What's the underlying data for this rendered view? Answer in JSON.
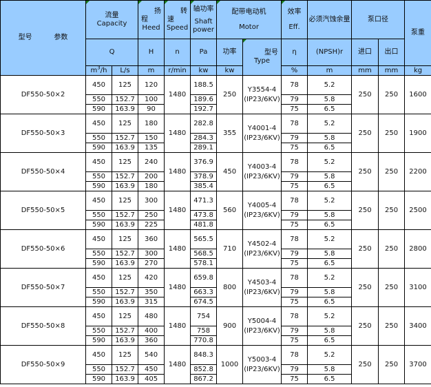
{
  "header": {
    "model_label": "型号",
    "param_label": "参数",
    "capacity_cn": "流量",
    "capacity_en": "Capacity",
    "head_cn_top": "扬",
    "head_cn_bottom": "程",
    "head_en": "Heed",
    "speed_cn_top": "转",
    "speed_cn_bottom": "速",
    "speed_en": "Speed",
    "shaft_cn": "轴功率",
    "shaft_en_1": "Shaft",
    "shaft_en_2": "power",
    "motor_cn": "配带电动机",
    "motor_en": "Motor",
    "eff_cn": "效率",
    "eff_en": "Eff.",
    "npsh_cn": "必须汽蚀余量",
    "bore_cn": "泵口径",
    "weight_cn": "泵重",
    "sym_q": "Q",
    "sym_h": "H",
    "sym_n": "n",
    "sym_pa": "Pa",
    "motor_power_cn": "功率",
    "motor_type_cn": "型号",
    "motor_type_en": "Type",
    "sym_eta": "η",
    "sym_npsh": "(NPSH)r",
    "inlet_cn": "进口",
    "outlet_cn": "出口",
    "unit_q1_base": "m",
    "unit_q1_sup": "3",
    "unit_q1_rest": "/h",
    "unit_q2": "L/s",
    "unit_h": "m",
    "unit_n": "r/min",
    "unit_pa": "kw",
    "unit_motor_kw": "kw",
    "unit_eta": "%",
    "unit_npsh": "m",
    "unit_inlet": "mm",
    "unit_outlet": "mm",
    "unit_weight": "kg"
  },
  "models": [
    {
      "model": "DF550-50×2",
      "speed": "1480",
      "motor_kw": "250",
      "motor_type_1": "Y3554-4",
      "motor_type_2": "(IP23/6KV)",
      "inlet": "250",
      "outlet": "250",
      "weight": "1600",
      "rows": [
        {
          "q_m3h": "450",
          "q_ls": "125",
          "h": "120",
          "pa": "188.5",
          "eta": "78",
          "npsh": "5.2"
        },
        {
          "q_m3h": "550",
          "q_ls": "152.7",
          "h": "100",
          "pa": "189.6",
          "eta": "79",
          "npsh": "5.8"
        },
        {
          "q_m3h": "590",
          "q_ls": "163.9",
          "h": "90",
          "pa": "192.7",
          "eta": "75",
          "npsh": "6.5"
        }
      ]
    },
    {
      "model": "DF550-50×3",
      "speed": "1480",
      "motor_kw": "355",
      "motor_type_1": "Y4001-4",
      "motor_type_2": "(IP23/6KV)",
      "inlet": "250",
      "outlet": "250",
      "weight": "1900",
      "rows": [
        {
          "q_m3h": "450",
          "q_ls": "125",
          "h": "180",
          "pa": "282.8",
          "eta": "78",
          "npsh": "5.2"
        },
        {
          "q_m3h": "550",
          "q_ls": "152.7",
          "h": "150",
          "pa": "284.3",
          "eta": "79",
          "npsh": "5.8"
        },
        {
          "q_m3h": "590",
          "q_ls": "163.9",
          "h": "135",
          "pa": "289.1",
          "eta": "75",
          "npsh": "6.5"
        }
      ]
    },
    {
      "model": "DF550-50×4",
      "speed": "1480",
      "motor_kw": "450",
      "motor_type_1": "Y4003-4",
      "motor_type_2": "(IP23/6KV)",
      "inlet": "250",
      "outlet": "250",
      "weight": "2200",
      "rows": [
        {
          "q_m3h": "450",
          "q_ls": "125",
          "h": "240",
          "pa": "376.9",
          "eta": "78",
          "npsh": "5.2"
        },
        {
          "q_m3h": "550",
          "q_ls": "152.7",
          "h": "200",
          "pa": "378.9",
          "eta": "79",
          "npsh": "5.8"
        },
        {
          "q_m3h": "590",
          "q_ls": "163.9",
          "h": "180",
          "pa": "385.4",
          "eta": "75",
          "npsh": "6.5"
        }
      ]
    },
    {
      "model": "DF550-50×5",
      "speed": "1480",
      "motor_kw": "560",
      "motor_type_1": "Y4005-4",
      "motor_type_2": "(IP23/6KV)",
      "inlet": "250",
      "outlet": "250",
      "weight": "2500",
      "rows": [
        {
          "q_m3h": "450",
          "q_ls": "125",
          "h": "300",
          "pa": "471.3",
          "eta": "78",
          "npsh": "5.2"
        },
        {
          "q_m3h": "550",
          "q_ls": "152.7",
          "h": "250",
          "pa": "473.8",
          "eta": "79",
          "npsh": "5.8"
        },
        {
          "q_m3h": "590",
          "q_ls": "163.9",
          "h": "225",
          "pa": "481.8",
          "eta": "75",
          "npsh": "6.5"
        }
      ]
    },
    {
      "model": "DF550-50×6",
      "speed": "1480",
      "motor_kw": "710",
      "motor_type_1": "Y4502-4",
      "motor_type_2": "(IP23/6KV)",
      "inlet": "250",
      "outlet": "250",
      "weight": "2800",
      "rows": [
        {
          "q_m3h": "450",
          "q_ls": "125",
          "h": "360",
          "pa": "565.5",
          "eta": "78",
          "npsh": "5.2"
        },
        {
          "q_m3h": "550",
          "q_ls": "152.7",
          "h": "300",
          "pa": "568.5",
          "eta": "79",
          "npsh": "5.8"
        },
        {
          "q_m3h": "590",
          "q_ls": "163.9",
          "h": "270",
          "pa": "578.1",
          "eta": "75",
          "npsh": "6.5"
        }
      ]
    },
    {
      "model": "DF550-50×7",
      "speed": "1480",
      "motor_kw": "800",
      "motor_type_1": "Y4503-4",
      "motor_type_2": "(IP23/6KV)",
      "inlet": "250",
      "outlet": "250",
      "weight": "3100",
      "rows": [
        {
          "q_m3h": "450",
          "q_ls": "125",
          "h": "420",
          "pa": "659.8",
          "eta": "78",
          "npsh": "5.2"
        },
        {
          "q_m3h": "550",
          "q_ls": "152.7",
          "h": "350",
          "pa": "663.3",
          "eta": "79",
          "npsh": "5.8"
        },
        {
          "q_m3h": "590",
          "q_ls": "163.9",
          "h": "315",
          "pa": "674.5",
          "eta": "75",
          "npsh": "6.5"
        }
      ]
    },
    {
      "model": "DF550-50×8",
      "speed": "1480",
      "motor_kw": "900",
      "motor_type_1": "Y5004-4",
      "motor_type_2": "(IP23/6KV)",
      "inlet": "250",
      "outlet": "250",
      "weight": "3400",
      "rows": [
        {
          "q_m3h": "450",
          "q_ls": "125",
          "h": "480",
          "pa": "754",
          "eta": "78",
          "npsh": "5.2"
        },
        {
          "q_m3h": "550",
          "q_ls": "152.7",
          "h": "400",
          "pa": "758",
          "eta": "79",
          "npsh": "5.8"
        },
        {
          "q_m3h": "590",
          "q_ls": "163.9",
          "h": "360",
          "pa": "770.8",
          "eta": "75",
          "npsh": "6.5"
        }
      ]
    },
    {
      "model": "DF550-50×9",
      "speed": "1480",
      "motor_kw": "1000",
      "motor_type_1": "Y5003-4",
      "motor_type_2": "(IP23/6KV)",
      "inlet": "250",
      "outlet": "250",
      "weight": "3700",
      "rows": [
        {
          "q_m3h": "450",
          "q_ls": "125",
          "h": "540",
          "pa": "848.3",
          "eta": "78",
          "npsh": "5.2"
        },
        {
          "q_m3h": "550",
          "q_ls": "152.7",
          "h": "450",
          "pa": "852.8",
          "eta": "79",
          "npsh": "5.8"
        },
        {
          "q_m3h": "590",
          "q_ls": "163.9",
          "h": "405",
          "pa": "867.2",
          "eta": "75",
          "npsh": "6.5"
        }
      ]
    }
  ]
}
